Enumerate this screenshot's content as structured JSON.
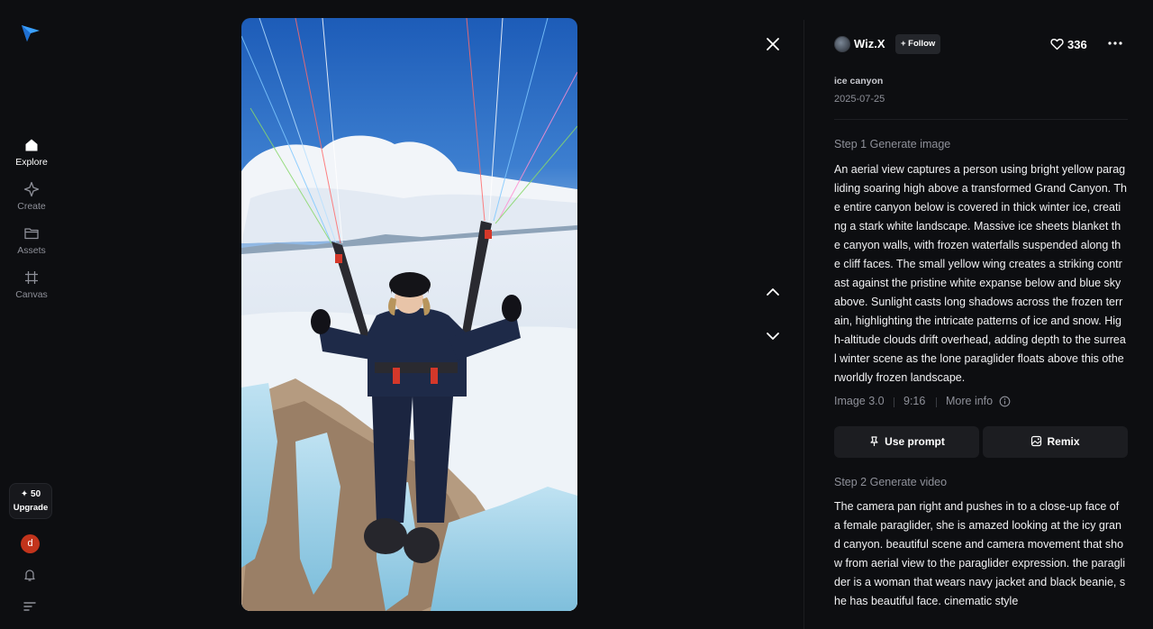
{
  "sidebar": {
    "items": [
      {
        "label": "Explore",
        "icon": "home-icon"
      },
      {
        "label": "Create",
        "icon": "sparkle-icon"
      },
      {
        "label": "Assets",
        "icon": "folder-icon"
      },
      {
        "label": "Canvas",
        "icon": "canvas-icon"
      }
    ],
    "credits": "✦ 50",
    "upgrade_label": "Upgrade",
    "user_initial": "d"
  },
  "post": {
    "author": "Wiz.X",
    "follow_label": "+ Follow",
    "likes": "336",
    "title": "ice canyon",
    "date": "2025-07-25"
  },
  "step1": {
    "label": "Step 1 Generate image",
    "prompt": "An aerial view captures a person using bright yellow paragliding soaring high above a transformed Grand Canyon. The entire canyon below is covered in thick winter ice, creating a stark white landscape. Massive ice sheets blanket the canyon walls, with frozen waterfalls suspended along the cliff faces. The small yellow wing creates a striking contrast against the pristine white expanse below and blue sky above. Sunlight casts long shadows across the frozen terrain, highlighting the intricate patterns of ice and snow. High-altitude clouds drift overhead, adding depth to the surreal winter scene as the lone paraglider floats above this otherworldly frozen landscape.",
    "model": "Image 3.0",
    "ratio": "9:16",
    "more_info": "More info"
  },
  "actions": {
    "use_prompt": "Use prompt",
    "remix": "Remix"
  },
  "step2": {
    "label": "Step 2 Generate video",
    "prompt": "The camera pan right and pushes in to a close-up face of a female paraglider, she is amazed looking at the icy grand canyon. beautiful scene and camera movement that show from aerial view to the paraglider expression. the paraglider is a woman that wears navy jacket and black beanie, she has beautiful face. cinematic style"
  },
  "colors": {
    "background": "#0d0e11",
    "button_bg": "#1c1d21",
    "muted_text": "#8e9099",
    "user_avatar": "#c2341c",
    "logo": "#3aa0ff"
  }
}
